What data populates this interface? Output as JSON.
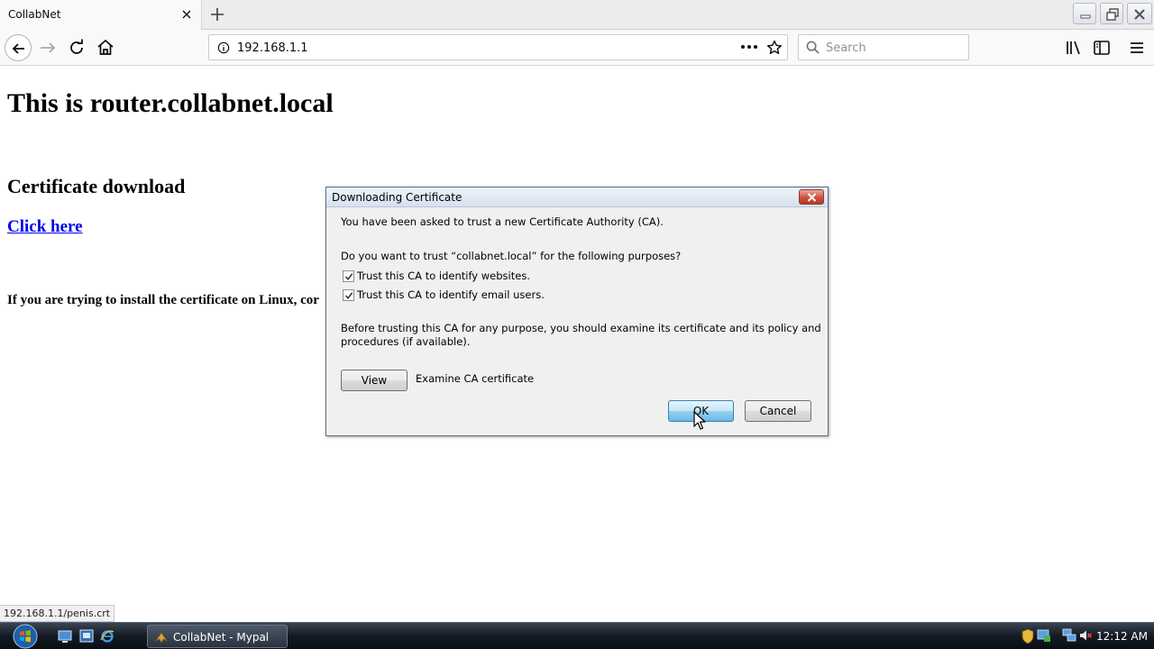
{
  "browser": {
    "tab": {
      "title": "CollabNet"
    },
    "url": "192.168.1.1",
    "search": {
      "placeholder": "Search"
    }
  },
  "page": {
    "heading": "This is router.collabnet.local",
    "subheading": "Certificate download",
    "link_text": "Click here",
    "linux_note": "If you are trying to install the certificate on Linux, cor",
    "status_url": "192.168.1.1/penis.crt"
  },
  "dialog": {
    "title": "Downloading Certificate",
    "intro": "You have been asked to trust a new Certificate Authority (CA).",
    "question": "Do you want to trust “collabnet.local” for the following purposes?",
    "checkboxes": [
      {
        "label": "Trust this CA to identify websites.",
        "checked": true
      },
      {
        "label": "Trust this CA to identify email users.",
        "checked": true
      }
    ],
    "advice_line1": "Before trusting this CA for any purpose, you should examine its certificate and its policy and",
    "advice_line2": "procedures (if available).",
    "view_button": "View",
    "view_caption": "Examine CA certificate",
    "ok_button": "OK",
    "cancel_button": "Cancel"
  },
  "taskbar": {
    "window_button": "CollabNet - Mypal",
    "clock": "12:12 AM"
  },
  "colors": {
    "link": "#0000ee",
    "dialog_titlebar": "#d6e1ee",
    "default_button": "#98d1ef",
    "taskbar": "#141a23"
  }
}
